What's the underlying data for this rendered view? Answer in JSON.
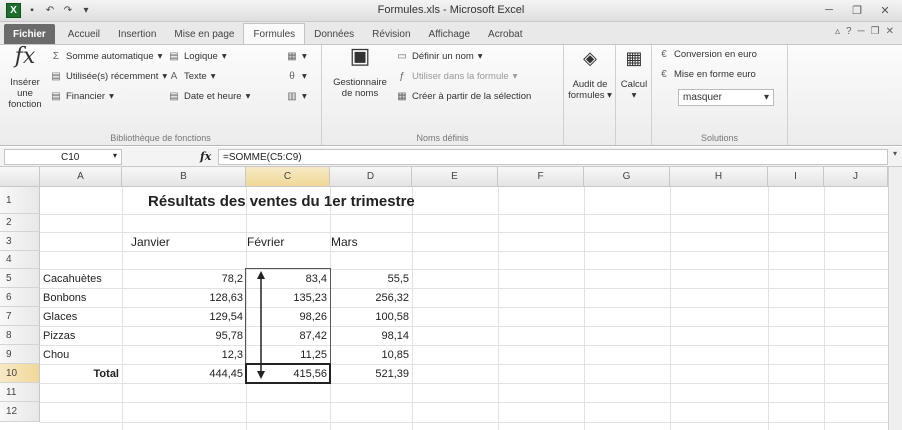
{
  "window": {
    "title": "Formules.xls - Microsoft Excel"
  },
  "tabs": [
    "Fichier",
    "Accueil",
    "Insertion",
    "Mise en page",
    "Formules",
    "Données",
    "Révision",
    "Affichage",
    "Acrobat"
  ],
  "ribbon": {
    "insert_function": {
      "line1": "Insérer une",
      "line2": "fonction"
    },
    "library": {
      "autosum": "Somme automatique",
      "recent": "Utilisée(s) récemment",
      "financial": "Financier",
      "logical": "Logique",
      "text": "Texte",
      "datetime": "Date et heure",
      "label": "Bibliothèque de fonctions"
    },
    "names": {
      "manager_line1": "Gestionnaire",
      "manager_line2": "de noms",
      "define": "Définir un nom",
      "use": "Utiliser dans la formule",
      "create": "Créer à partir de la sélection",
      "label": "Noms définis"
    },
    "audit": {
      "line1": "Audit de",
      "line2": "formules"
    },
    "calc": {
      "label": "Calcul"
    },
    "solutions": {
      "conversion": "Conversion en euro",
      "format": "Mise en forme euro",
      "combo_value": "masquer",
      "label": "Solutions"
    }
  },
  "formula_bar": {
    "name_box": "C10",
    "formula": "=SOMME(C5:C9)"
  },
  "grid": {
    "columns": [
      "A",
      "B",
      "C",
      "D",
      "E",
      "F",
      "G",
      "H",
      "I",
      "J"
    ],
    "rows": [
      "1",
      "2",
      "3",
      "4",
      "5",
      "6",
      "7",
      "8",
      "9",
      "10",
      "11",
      "12"
    ],
    "title": "Résultats des ventes du 1er trimestre",
    "months": [
      "Janvier",
      "Février",
      "Mars"
    ],
    "data": [
      {
        "label": "Cacahuètes",
        "b": "78,2",
        "c": "83,4",
        "d": "55,5"
      },
      {
        "label": "Bonbons",
        "b": "128,63",
        "c": "135,23",
        "d": "256,32"
      },
      {
        "label": "Glaces",
        "b": "129,54",
        "c": "98,26",
        "d": "100,58"
      },
      {
        "label": "Pizzas",
        "b": "95,78",
        "c": "87,42",
        "d": "98,14"
      },
      {
        "label": "Chou",
        "b": "12,3",
        "c": "11,25",
        "d": "10,85"
      }
    ],
    "total": {
      "label": "Total",
      "b": "444,45",
      "c": "415,56",
      "d": "521,39"
    }
  }
}
